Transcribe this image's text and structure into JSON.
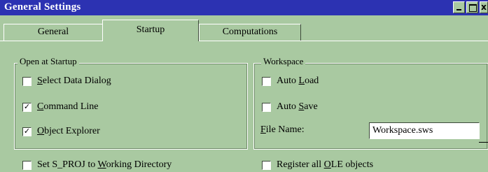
{
  "window": {
    "title": "General Settings",
    "controls": {
      "minimize": "_",
      "maximize": "□",
      "close": "x"
    }
  },
  "tabs": [
    {
      "label": "General",
      "active": false
    },
    {
      "label": "Startup",
      "active": true
    },
    {
      "label": "Computations",
      "active": false
    }
  ],
  "open_at_startup": {
    "legend": "Open at Startup",
    "items": [
      {
        "pre": "",
        "key": "S",
        "post": "elect Data Dialog",
        "checked": false
      },
      {
        "pre": "",
        "key": "C",
        "post": "ommand Line",
        "checked": true
      },
      {
        "pre": "",
        "key": "O",
        "post": "bject Explorer",
        "checked": true
      }
    ]
  },
  "workspace": {
    "legend": "Workspace",
    "auto_load": {
      "pre": "Auto ",
      "key": "L",
      "post": "oad",
      "checked": false
    },
    "auto_save": {
      "pre": "Auto ",
      "key": "S",
      "post": "ave",
      "checked": false
    },
    "file_name_label": {
      "pre": "",
      "key": "F",
      "post": "ile Name:"
    },
    "file_name_value": "Workspace.sws"
  },
  "bottom": {
    "set_sproj": {
      "pre": "Set S_PROJ to ",
      "key": "W",
      "post": "orking Directory",
      "checked": false
    },
    "register_ole": {
      "pre": "Register all ",
      "key": "O",
      "post": "LE objects",
      "checked": false
    }
  },
  "check_mark": "✓"
}
